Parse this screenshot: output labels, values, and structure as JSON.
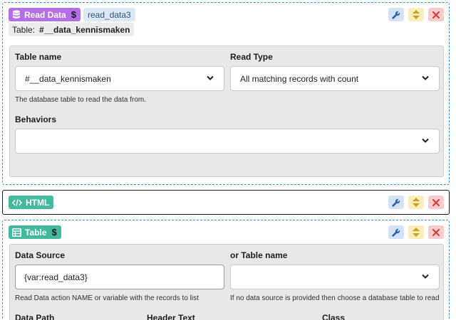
{
  "read_block": {
    "badge_label": "Read Data",
    "badge_icon": "database-icon",
    "dollar": "$",
    "name": "read_data3",
    "table_prefix": "Table:",
    "table_value": "#__data_kennismaken",
    "fields": {
      "table_name_label": "Table name",
      "table_name_value": "#__data_kennismaken",
      "table_name_help": "The database table to read the data from.",
      "read_type_label": "Read Type",
      "read_type_value": "All matching records with count",
      "behaviors_label": "Behaviors",
      "behaviors_value": ""
    }
  },
  "html_block": {
    "badge_label": "HTML",
    "badge_icon": "code-icon"
  },
  "table_block": {
    "badge_label": "Table",
    "badge_icon": "table-icon",
    "dollar": "$",
    "fields": {
      "data_source_label": "Data Source",
      "data_source_value": "{var:read_data3}",
      "data_source_help": "Read Data action NAME or variable with the records to list",
      "table_name_label": "or Table name",
      "table_name_value": "",
      "table_name_help": "If no data source is provided then choose a database table to read",
      "data_path_label": "Data Path",
      "header_text_label": "Header Text",
      "class_label": "Class"
    }
  },
  "controls": {
    "settings_icon": "wrench-icon",
    "move_icon": "sort-icon",
    "delete_icon": "close-icon"
  },
  "colors": {
    "read_badge": "#b46ee6",
    "html_badge": "#45b99c",
    "table_badge": "#45b99c",
    "dashed_border": "#3b8fe0",
    "wrench": "#2b5fa8",
    "sort": "#c9a316",
    "close": "#d23a3a"
  }
}
